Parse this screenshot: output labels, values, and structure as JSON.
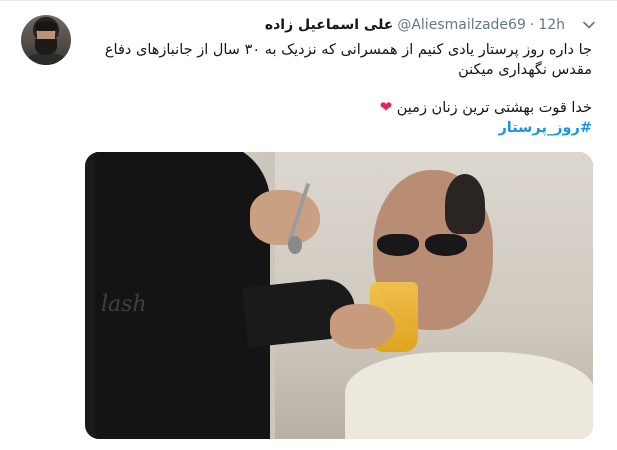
{
  "tweet": {
    "display_name": "علی اسماعیل زاده",
    "handle": "@Aliesmailzade69",
    "separator": "·",
    "time": "12h",
    "text_line1": "جا داره روز پرستار یادی کنیم از همسرانی که نزدیک به ۳۰ سال از جانبازهای دفاع",
    "text_line2": "مقدس نگهداری میکنن",
    "text_line3": "خدا قوت بهشتی ترین زنان زمین",
    "hashtag": "#روز_پرستار"
  },
  "media": {
    "watermark": "lash"
  },
  "icons": {
    "caret": "chevron-down-icon",
    "heart": "red-heart-emoji"
  },
  "colors": {
    "link": "#1b95e0",
    "secondary_text": "#657786",
    "heart": "#e0245e"
  }
}
